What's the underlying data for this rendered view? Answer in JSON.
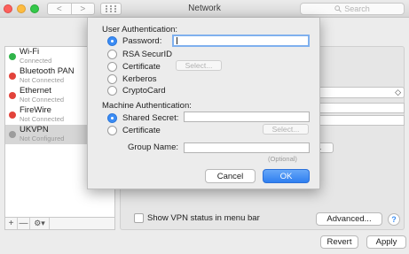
{
  "window": {
    "title": "Network",
    "search_placeholder": "Search",
    "nav_back_icon": "chevron-left-icon",
    "nav_forward_icon": "chevron-right-icon",
    "grid_icon": "grid-icon",
    "back_glyph": "<",
    "forward_glyph": ">"
  },
  "sidebar": {
    "services": [
      {
        "name": "Wi-Fi",
        "status": "Connected",
        "status_color": "#30b44a"
      },
      {
        "name": "Bluetooth PAN",
        "status": "Not Connected",
        "status_color": "#e2433b"
      },
      {
        "name": "Ethernet",
        "status": "Not Connected",
        "status_color": "#e2433b"
      },
      {
        "name": "FireWire",
        "status": "Not Connected",
        "status_color": "#e2433b"
      },
      {
        "name": "UKVPN",
        "status": "Not Configured",
        "status_color": "#9c9c9c"
      }
    ],
    "toolbar": {
      "add": "+",
      "remove": "—",
      "gear": "⚙▾"
    }
  },
  "main": {
    "show_vpn_status_label": "Show VPN status in menu bar",
    "advanced_label": "Advanced...",
    "help_label": "?",
    "revert_label": "Revert",
    "apply_label": "Apply",
    "stub_button": "..",
    "select_chevron": "◇"
  },
  "sheet": {
    "user_auth_title": "User Authentication:",
    "user_options": [
      {
        "label": "Password:",
        "selected": true
      },
      {
        "label": "RSA SecurID",
        "selected": false
      },
      {
        "label": "Certificate",
        "selected": false
      },
      {
        "label": "Kerberos",
        "selected": false
      },
      {
        "label": "CryptoCard",
        "selected": false
      }
    ],
    "user_select_label": "Select...",
    "machine_auth_title": "Machine Authentication:",
    "machine_options": [
      {
        "label": "Shared Secret:",
        "selected": true
      },
      {
        "label": "Certificate",
        "selected": false
      }
    ],
    "machine_select_label": "Select...",
    "group_name_label": "Group Name:",
    "group_name_hint": "(Optional)",
    "cancel_label": "Cancel",
    "ok_label": "OK"
  },
  "colors": {
    "accent": "#3b8cf5",
    "connected": "#30b44a",
    "disconnected": "#e2433b"
  }
}
